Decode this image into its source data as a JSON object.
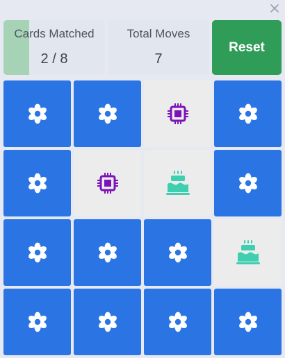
{
  "stats": {
    "matched_label": "Cards Matched",
    "matched_value": "2 / 8",
    "matched_fraction": 0.25,
    "moves_label": "Total Moves",
    "moves_value": "7"
  },
  "reset_label": "Reset",
  "colors": {
    "card_back": "#2b74e4",
    "card_face": "#ececec",
    "chip_icon": "#7a13b8",
    "cake_icon": "#3ecfb0",
    "reset_button": "#2f9c57",
    "progress_fill": "#a6d2b5"
  },
  "cards": [
    {
      "state": "hidden",
      "icon": "flower-icon"
    },
    {
      "state": "hidden",
      "icon": "flower-icon"
    },
    {
      "state": "revealed",
      "icon": "chip-icon"
    },
    {
      "state": "hidden",
      "icon": "flower-icon"
    },
    {
      "state": "hidden",
      "icon": "flower-icon"
    },
    {
      "state": "revealed",
      "icon": "chip-icon"
    },
    {
      "state": "revealed",
      "icon": "cake-icon"
    },
    {
      "state": "hidden",
      "icon": "flower-icon"
    },
    {
      "state": "hidden",
      "icon": "flower-icon"
    },
    {
      "state": "hidden",
      "icon": "flower-icon"
    },
    {
      "state": "hidden",
      "icon": "flower-icon"
    },
    {
      "state": "revealed",
      "icon": "cake-icon"
    },
    {
      "state": "hidden",
      "icon": "flower-icon"
    },
    {
      "state": "hidden",
      "icon": "flower-icon"
    },
    {
      "state": "hidden",
      "icon": "flower-icon"
    },
    {
      "state": "hidden",
      "icon": "flower-icon"
    }
  ]
}
